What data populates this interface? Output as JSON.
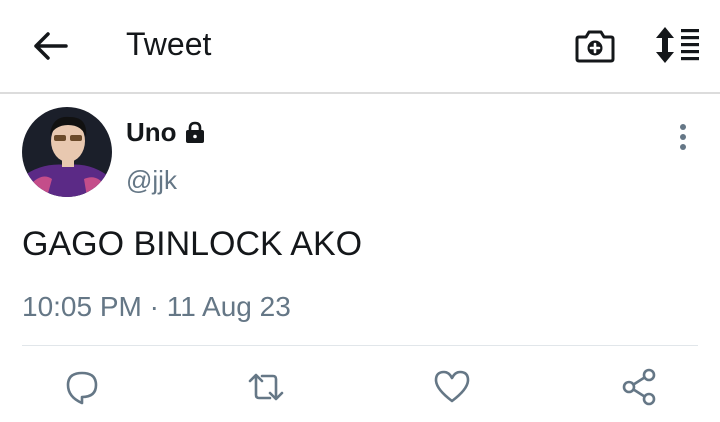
{
  "header": {
    "title": "Tweet",
    "icons": {
      "back": "arrow-left-icon",
      "camera": "camera-add-icon",
      "sort": "sort-list-icon"
    }
  },
  "tweet": {
    "author": {
      "display_name": "Uno",
      "handle": "@jjk",
      "protected": true
    },
    "text": "GAGO BINLOCK AKO",
    "time": "10:05 PM",
    "separator": "·",
    "date": "11 Aug 23"
  },
  "actions": [
    "reply-icon",
    "retweet-icon",
    "like-icon",
    "share-icon"
  ],
  "colors": {
    "text": "#14171a",
    "secondary": "#657786",
    "divider": "#e1e6ea"
  }
}
